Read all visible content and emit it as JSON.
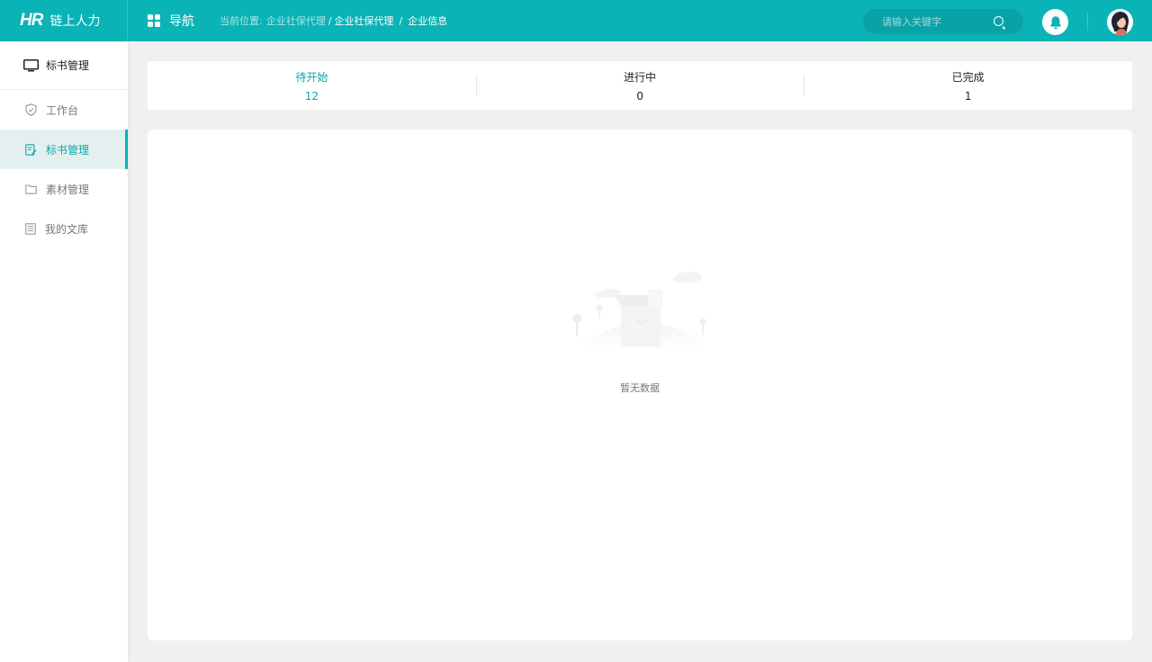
{
  "header": {
    "logo_mark": "HR",
    "logo_text": "链上人力",
    "nav_label": "导航",
    "breadcrumb_prefix": "当前位置:",
    "breadcrumb": [
      "企业社保代理",
      "企业社保代理",
      "企业信息"
    ],
    "breadcrumb_separator": "/",
    "search_placeholder": "请输入关键字",
    "accent_color": "#0ab3b6"
  },
  "sidebar": {
    "header_icon": "monitor-icon",
    "header_title": "标书管理",
    "items": [
      {
        "label": "工作台",
        "icon": "shield-icon",
        "active": false
      },
      {
        "label": "标书管理",
        "icon": "edit-doc-icon",
        "active": true
      },
      {
        "label": "素材管理",
        "icon": "folder-icon",
        "active": false
      },
      {
        "label": "我的文库",
        "icon": "document-list-icon",
        "active": false
      }
    ]
  },
  "stats": [
    {
      "label": "待开始",
      "count": "12",
      "active": true
    },
    {
      "label": "进行中",
      "count": "0",
      "active": false
    },
    {
      "label": "已完成",
      "count": "1",
      "active": false
    }
  ],
  "empty_state": {
    "text": "暂无数据",
    "icon": "empty-box-illustration"
  }
}
